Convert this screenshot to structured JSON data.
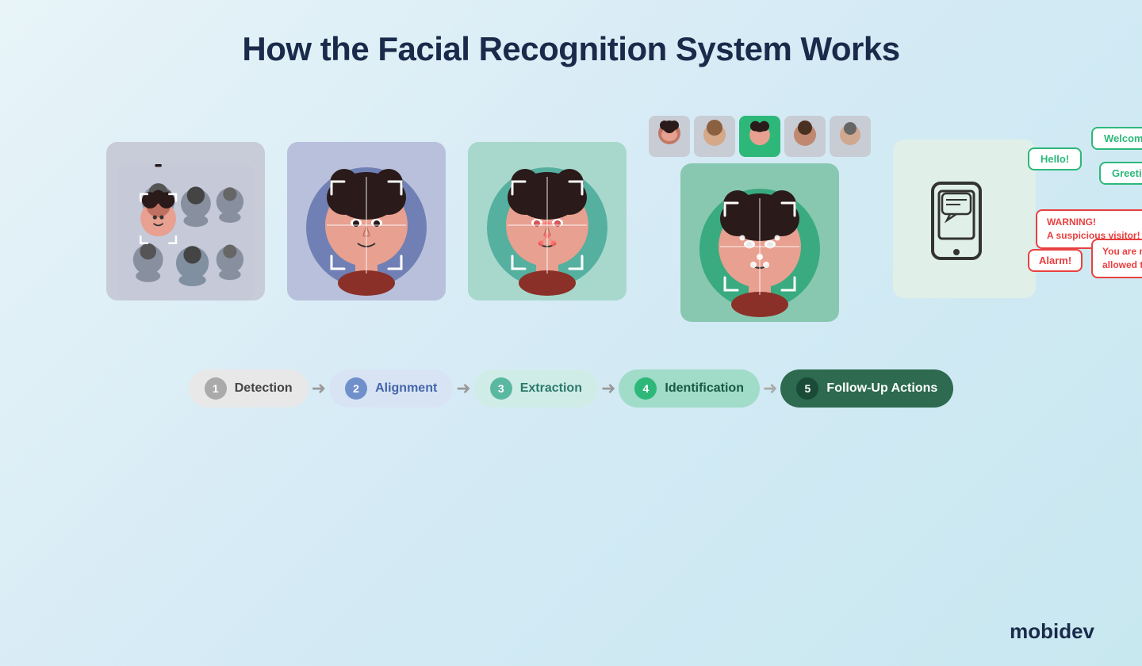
{
  "page": {
    "title": "How the Facial Recognition System Works",
    "background": "linear-gradient(135deg, #e8f4f8, #c8e8f0)"
  },
  "steps": [
    {
      "id": 1,
      "label": "Detection",
      "pill_style": "pill-1"
    },
    {
      "id": 2,
      "label": "Alignment",
      "pill_style": "pill-2"
    },
    {
      "id": 3,
      "label": "Extraction",
      "pill_style": "pill-3"
    },
    {
      "id": 4,
      "label": "Identification",
      "pill_style": "pill-4"
    },
    {
      "id": 5,
      "label": "Follow-Up Actions",
      "pill_style": "pill-5"
    }
  ],
  "notifications": {
    "green": [
      "Hello!",
      "Welcome!",
      "Greetings!!"
    ],
    "red": [
      "WARNING!\nA suspicious visitor!",
      "Alarm!",
      "You are not\nallowed to pass!"
    ]
  },
  "logo": {
    "text_mobi": "mobi",
    "text_dev": "dev"
  }
}
